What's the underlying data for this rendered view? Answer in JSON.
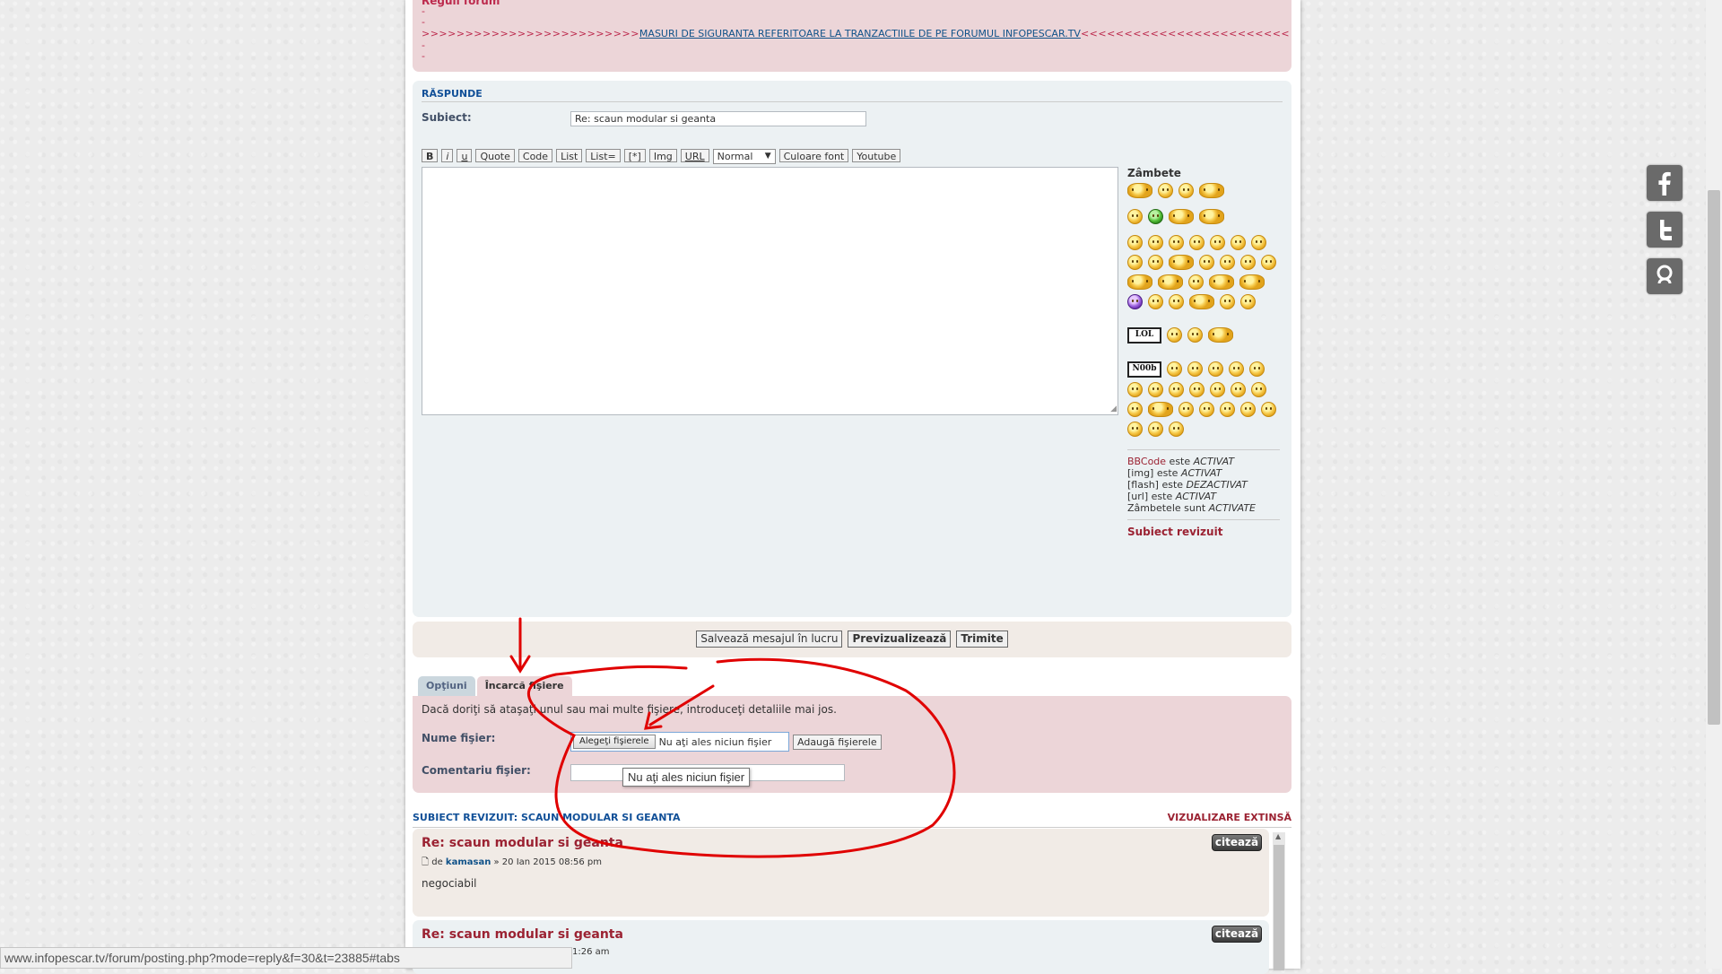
{
  "rules": {
    "title": "Reguli forum",
    "dash": "-",
    "arrows_left": ">>>>>>>>>>>>>>>>>>>>>>>>>",
    "link": "MASURI DE SIGURANTA REFERITOARE LA TRANZACTIILE DE PE FORUMUL INFOPESCAR.TV",
    "arrows_right": "<<<<<<<<<<<<<<<<<<<<<<<<"
  },
  "reply": {
    "section_title": "RĂSPUNDE",
    "subject_label": "Subiect:",
    "subject_value": "Re: scaun modular si geanta",
    "toolbar": {
      "bold": "B",
      "italic": "i",
      "underline": "u",
      "quote": "Quote",
      "code": "Code",
      "list": "List",
      "list_ordered": "List=",
      "list_item": "[*]",
      "img": "Img",
      "url": "URL",
      "font_size": "Normal",
      "font_color": "Culoare font",
      "youtube": "Youtube"
    },
    "smilies_title": "Zâmbete",
    "sign_lol": "LOL",
    "sign_noob": "N00b",
    "bbcode": {
      "bbcode_link": "BBCode",
      "bbcode_text": " este ",
      "bbcode_state": "ACTIVAT",
      "img_text": "[img] este ",
      "img_state": "ACTIVAT",
      "flash_text": "[flash] este ",
      "flash_state": "DEZACTIVAT",
      "url_text": "[url] este ",
      "url_state": "ACTIVAT",
      "smilies_text": "Zâmbetele sunt ",
      "smilies_state": "ACTIVATE"
    },
    "revised_title": "Subiect revizuit"
  },
  "submit": {
    "save_draft": "Salvează mesajul în lucru",
    "preview": "Previzualizează",
    "send": "Trimite"
  },
  "tabs": {
    "options": "Opţiuni",
    "upload": "Încarcă fişiere"
  },
  "attach": {
    "intro": "Dacă doriţi să ataşaţi unul sau mai multe fişiere, introduceţi detaliile mai jos.",
    "filename_label": "Nume fişier:",
    "choose_files": "Alegeţi fişierele",
    "no_file": "Nu aţi ales niciun fişier",
    "add_file": "Adaugă fişierele",
    "comment_label": "Comentariu fişier:",
    "tooltip": "Nu aţi ales niciun fişier"
  },
  "review": {
    "header": "SUBIECT REVIZUIT: SCAUN MODULAR SI GEANTA",
    "expand": "VIZUALIZARE EXTINSĂ",
    "quote_label": "citează",
    "posts": [
      {
        "title": "Re: scaun modular si geanta",
        "by": "de",
        "author": "kamasan",
        "date": "» 20 Ian 2015 08:56 pm",
        "body": "negociabil"
      },
      {
        "title": "Re: scaun modular si geanta",
        "date": "1:26 am"
      }
    ]
  },
  "status_url": "www.infopescar.tv/forum/posting.php?mode=reply&f=30&t=23885#tabs",
  "colors": {
    "rules_bg": "#ecd5d8",
    "reply_bg": "#ecf1f3",
    "accent_red": "#9b2232",
    "link_blue": "#105289",
    "annotation": "#e00000"
  },
  "icons": [
    "facebook-icon",
    "twitter-icon",
    "google-plus-icon",
    "post-icon"
  ]
}
